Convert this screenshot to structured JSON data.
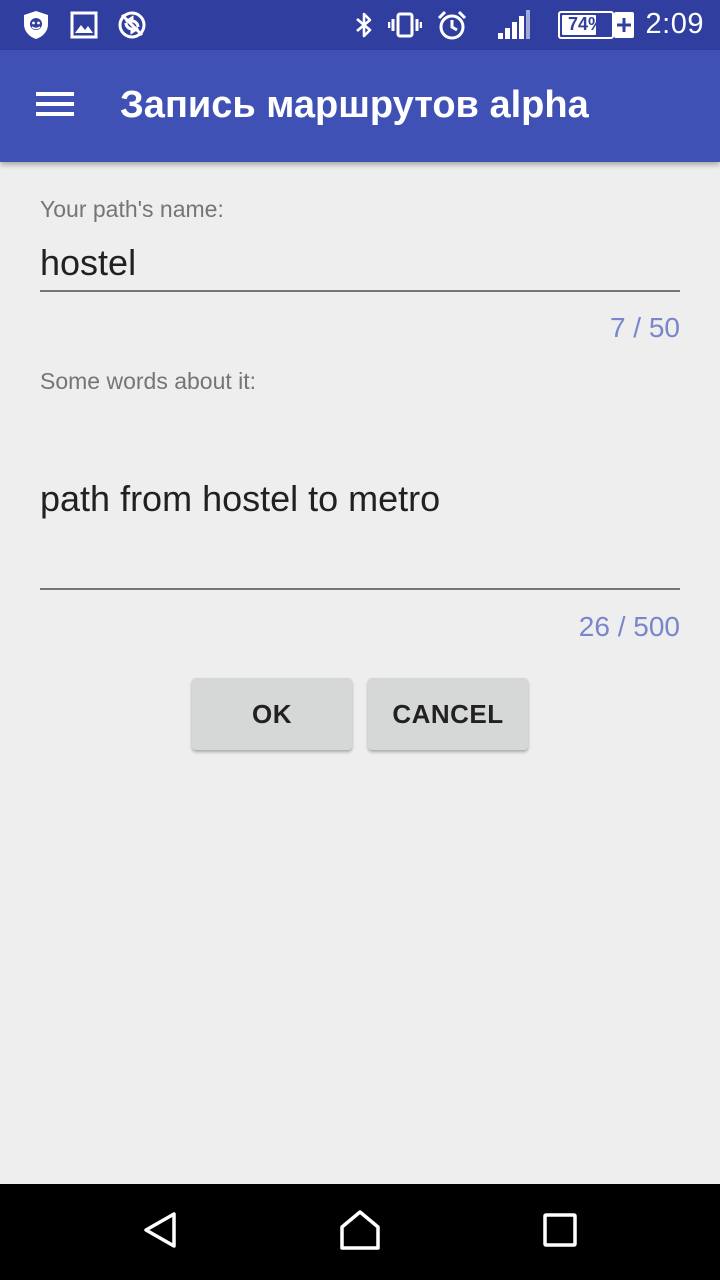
{
  "status_bar": {
    "time": "2:09",
    "battery_percent": "74%",
    "battery_level": 0.74,
    "icons": [
      "shield-icon",
      "image-icon",
      "no-sync-icon",
      "bluetooth-icon",
      "vibrate-icon",
      "alarm-icon",
      "signal-icon",
      "battery-charging-icon"
    ]
  },
  "app_bar": {
    "title": "Запись маршрутов alpha",
    "menu_icon": "hamburger-menu-icon"
  },
  "form": {
    "name_label": "Your path's name:",
    "name_value": "hostel",
    "name_counter": "7 / 50",
    "desc_label": "Some words about it:",
    "desc_value": "path from hostel to metro",
    "desc_counter": "26 / 500"
  },
  "buttons": {
    "ok_label": "OK",
    "cancel_label": "CANCEL"
  },
  "nav_bar": {
    "icons": [
      "back-icon",
      "home-icon",
      "recents-icon"
    ]
  },
  "colors": {
    "status_bar": "#303f9f",
    "app_bar": "#3f51b5",
    "counter": "#7986cb",
    "background": "#eeeeee"
  }
}
